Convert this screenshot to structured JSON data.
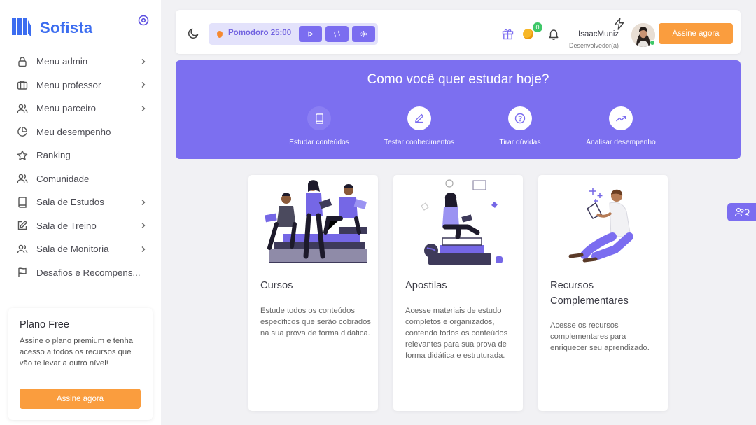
{
  "app": {
    "name": "Sofista",
    "brand_color": "#3c6df0",
    "accent_color": "#7c6ff0",
    "cta_color": "#fa9d3e"
  },
  "sidebar": {
    "items": [
      {
        "label": "Menu admin",
        "icon": "lock-icon",
        "has_chevron": true
      },
      {
        "label": "Menu professor",
        "icon": "briefcase-icon",
        "has_chevron": true
      },
      {
        "label": "Menu parceiro",
        "icon": "users-icon",
        "has_chevron": true
      },
      {
        "label": "Meu desempenho",
        "icon": "pie-chart-icon",
        "has_chevron": false
      },
      {
        "label": "Ranking",
        "icon": "star-icon",
        "has_chevron": false
      },
      {
        "label": "Comunidade",
        "icon": "users-icon",
        "has_chevron": false
      },
      {
        "label": "Sala de Estudos",
        "icon": "book-icon",
        "has_chevron": true
      },
      {
        "label": "Sala de Treino",
        "icon": "edit-icon",
        "has_chevron": true
      },
      {
        "label": "Sala de Monitoria",
        "icon": "users-icon",
        "has_chevron": true
      },
      {
        "label": "Desafios e Recompens...",
        "icon": "flag-icon",
        "has_chevron": false
      }
    ],
    "plan": {
      "title": "Plano Free",
      "description": "Assine o plano premium e tenha acesso a todos os recursos que vão te levar a outro nível!",
      "cta": "Assine agora"
    }
  },
  "header": {
    "pomodoro_label": "Pomodoro 25:00",
    "coins_badge": "0",
    "user_name": "IsaacMuniz",
    "user_role": "Desenvolvedor(a)",
    "cta": "Assine agora"
  },
  "banner": {
    "title": "Como você quer estudar hoje?",
    "options": [
      {
        "label": "Estudar conteúdos",
        "icon": "book-icon",
        "active": true
      },
      {
        "label": "Testar conhecimentos",
        "icon": "pencil-icon",
        "active": false
      },
      {
        "label": "Tirar dúvidas",
        "icon": "help-circle-icon",
        "active": false
      },
      {
        "label": "Analisar desempenho",
        "icon": "trending-up-icon",
        "active": false
      }
    ]
  },
  "cards": [
    {
      "title": "Cursos",
      "description": "Estude todos os conteúdos específicos que serão cobrados na sua prova de forma didática."
    },
    {
      "title": "Apostilas",
      "description": "Acesse materiais de estudo completos e organizados, contendo todos os conteúdos relevantes para sua prova de forma didática e estruturada."
    },
    {
      "title": "Recursos Complementares",
      "description": "Acesse os recursos complementares para enriquecer seu aprendizado."
    }
  ]
}
